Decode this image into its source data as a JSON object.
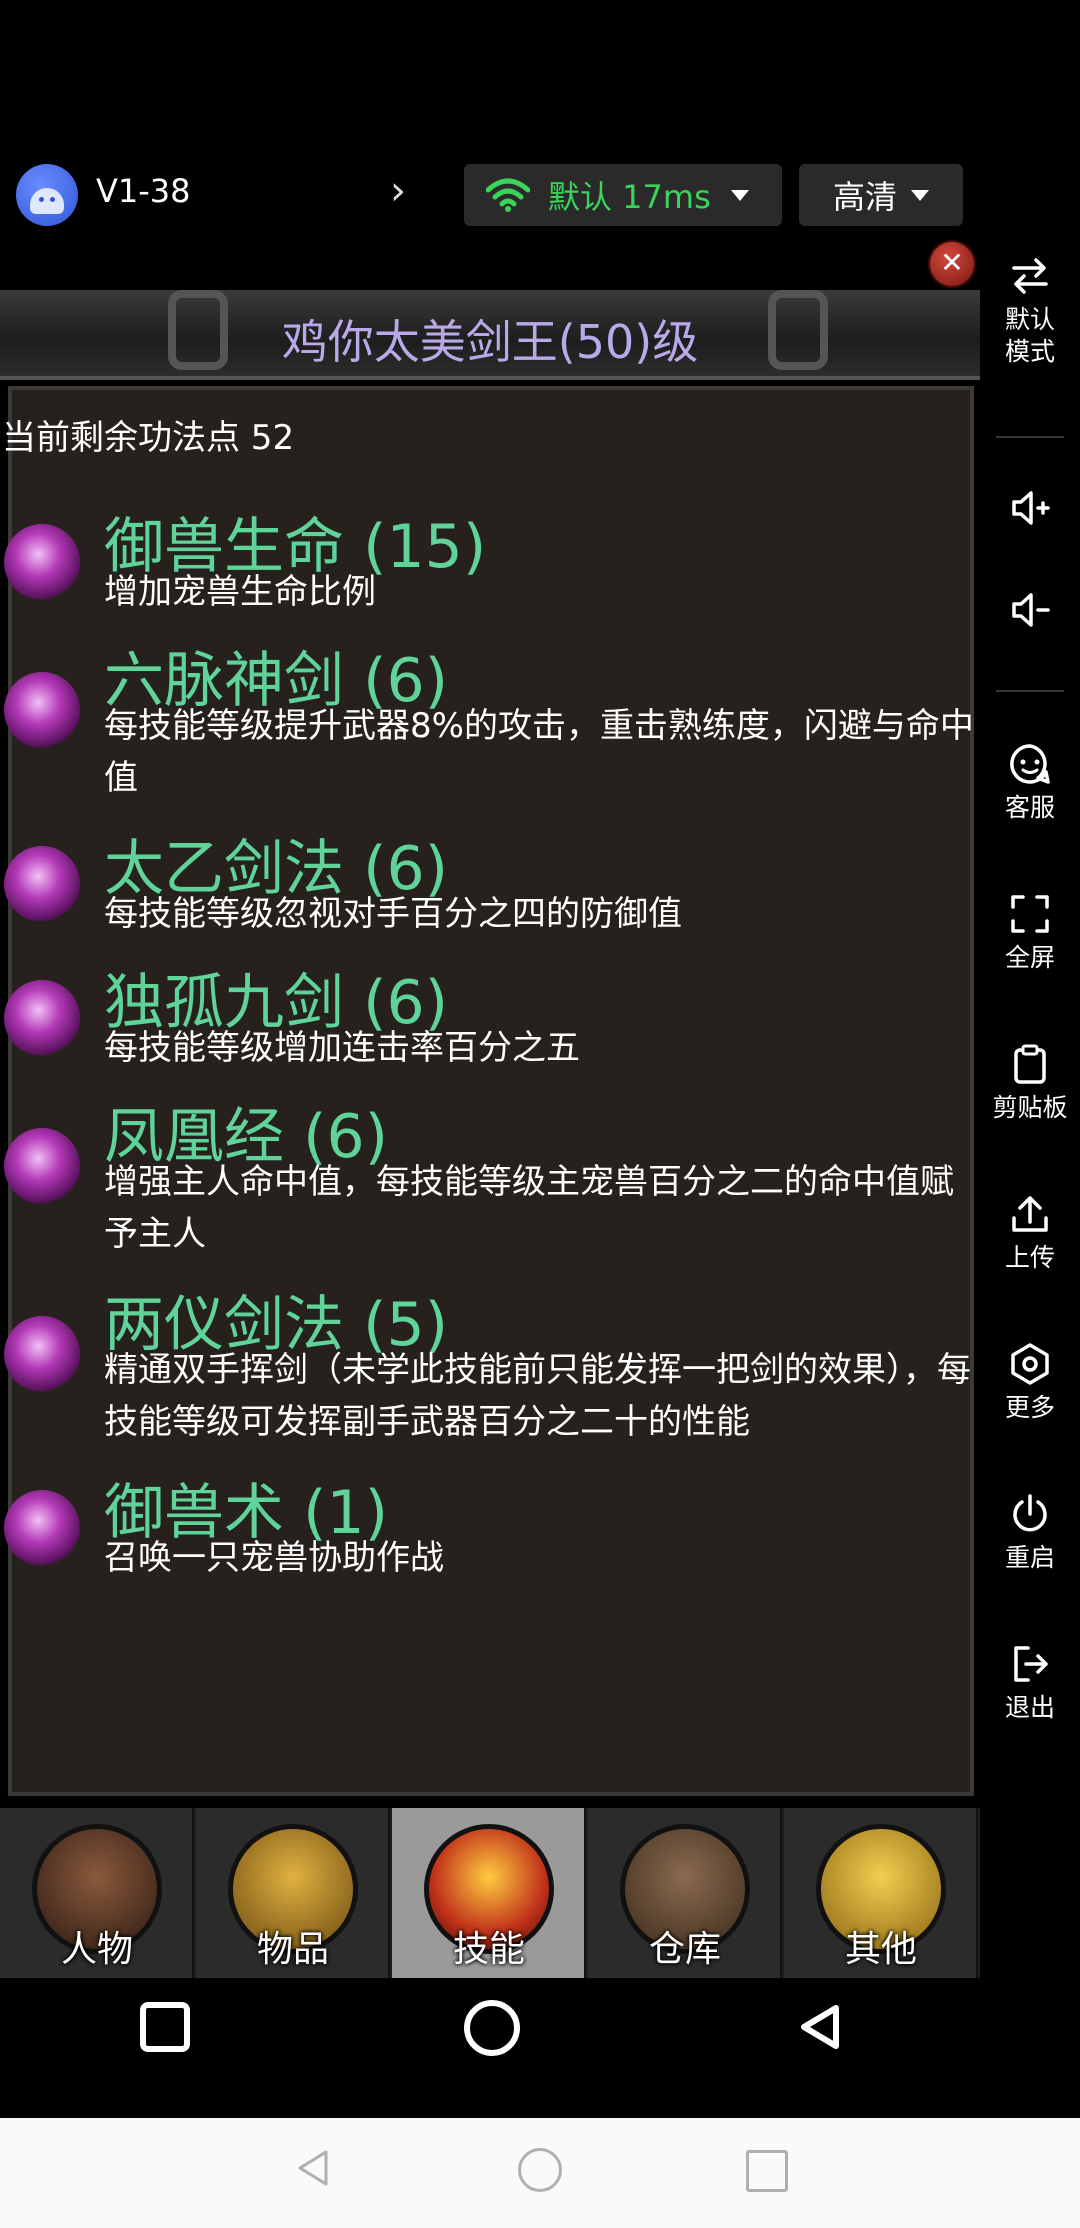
{
  "topbar": {
    "version": "V1-38",
    "network_label": "默认 17ms",
    "quality_label": "高清"
  },
  "sidebar": {
    "items": [
      {
        "label": "默认\n模式",
        "icon": "swap-arrows-icon"
      },
      {
        "label": "",
        "icon": "volume-up-icon"
      },
      {
        "label": "",
        "icon": "volume-down-icon"
      },
      {
        "label": "客服",
        "icon": "chat-icon"
      },
      {
        "label": "全屏",
        "icon": "fullscreen-icon"
      },
      {
        "label": "剪贴板",
        "icon": "clipboard-icon"
      },
      {
        "label": "上传",
        "icon": "upload-icon"
      },
      {
        "label": "更多",
        "icon": "more-hexagon-icon"
      },
      {
        "label": "重启",
        "icon": "power-icon"
      },
      {
        "label": "退出",
        "icon": "exit-icon"
      }
    ]
  },
  "game": {
    "title": "鸡你太美剑王(50)级",
    "points_text": "当前剩余功法点 52",
    "skills": [
      {
        "name": "御兽生命 (15)",
        "desc": "增加宠兽生命比例"
      },
      {
        "name": "六脉神剑 (6)",
        "desc": "每技能等级提升武器8%的攻击，重击熟练度，闪避与命中值"
      },
      {
        "name": "太乙剑法 (6)",
        "desc": "每技能等级忽视对手百分之四的防御值"
      },
      {
        "name": "独孤九剑 (6)",
        "desc": "每技能等级增加连击率百分之五"
      },
      {
        "name": "凤凰经 (6)",
        "desc": "增强主人命中值，每技能等级主宠兽百分之二的命中值赋予主人"
      },
      {
        "name": "两仪剑法 (5)",
        "desc": "精通双手挥剑（未学此技能前只能发挥一把剑的效果），每技能等级可发挥副手武器百分之二十的性能"
      },
      {
        "name": "御兽术 (1)",
        "desc": "召唤一只宠兽协助作战"
      }
    ],
    "tabs": [
      {
        "label": "人物",
        "active": false,
        "icon": "character-portrait-icon"
      },
      {
        "label": "物品",
        "active": false,
        "icon": "armor-icon"
      },
      {
        "label": "技能",
        "active": true,
        "icon": "sword-icon"
      },
      {
        "label": "仓库",
        "active": false,
        "icon": "treasure-chest-icon"
      },
      {
        "label": "其他",
        "active": false,
        "icon": "trophy-icon"
      }
    ]
  }
}
